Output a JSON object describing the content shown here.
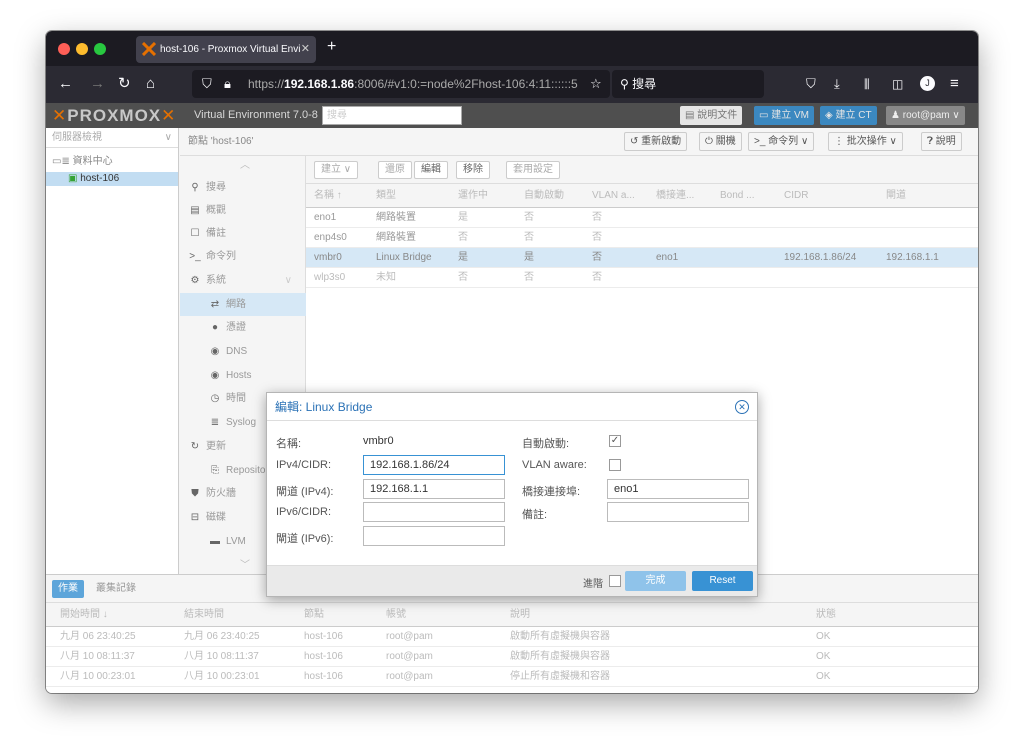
{
  "browser": {
    "tab_title": "host-106 - Proxmox Virtual Envi",
    "tab_close": "✕",
    "new_tab": "+",
    "url_pre": "https://",
    "url_host": "192.168.1.86",
    "url_rest": ":8006/#v1:0:=node%2Fhost-106:4:11::::::5",
    "search_label": "搜尋"
  },
  "pve": {
    "logo": "PROXMOX",
    "version": "Virtual Environment 7.0-8",
    "search_placeholder": "搜尋",
    "docs": "說明文件",
    "create_vm": "建立 VM",
    "create_ct": "建立 CT",
    "user": "root@pam"
  },
  "tree": {
    "view": "伺服器檢視",
    "datacenter": "資料中心",
    "node": "host-106"
  },
  "content": {
    "title": "節點 'host-106'",
    "reboot": "重新啟動",
    "shutdown": "關機",
    "shell": "命令列",
    "bulk": "批次操作",
    "help": "說明"
  },
  "menu": {
    "items": [
      {
        "icon": "⚲",
        "label": "搜尋"
      },
      {
        "icon": "▤",
        "label": "概觀"
      },
      {
        "icon": "☐",
        "label": "備註"
      },
      {
        "icon": ">_",
        "label": "命令列"
      },
      {
        "icon": "⚙",
        "label": "系統"
      },
      {
        "icon": "⇄",
        "label": "網路"
      },
      {
        "icon": "●",
        "label": "憑證"
      },
      {
        "icon": "◉",
        "label": "DNS"
      },
      {
        "icon": "◉",
        "label": "Hosts"
      },
      {
        "icon": "◷",
        "label": "時間"
      },
      {
        "icon": "≣",
        "label": "Syslog"
      },
      {
        "icon": "↻",
        "label": "更新"
      },
      {
        "icon": "⎘",
        "label": "Repositories"
      },
      {
        "icon": "⛊",
        "label": "防火牆"
      },
      {
        "icon": "⊟",
        "label": "磁碟"
      },
      {
        "icon": "▬",
        "label": "LVM"
      }
    ]
  },
  "grid": {
    "toolbar": [
      "建立 ∨",
      "還原",
      "編輯",
      "移除",
      "套用設定"
    ],
    "columns": [
      "名稱 ↑",
      "類型",
      "運作中",
      "自動啟動",
      "VLAN a...",
      "橋接連...",
      "Bond ...",
      "CIDR",
      "閘道"
    ],
    "rows": [
      [
        "eno1",
        "網路裝置",
        "是",
        "否",
        "否",
        "",
        "",
        "",
        ""
      ],
      [
        "enp4s0",
        "網路裝置",
        "否",
        "否",
        "否",
        "",
        "",
        "",
        ""
      ],
      [
        "vmbr0",
        "Linux Bridge",
        "是",
        "是",
        "否",
        "eno1",
        "",
        "192.168.1.86/24",
        "192.168.1.1"
      ],
      [
        "wlp3s0",
        "未知",
        "否",
        "否",
        "否",
        "",
        "",
        "",
        ""
      ]
    ]
  },
  "dialog": {
    "title": "編輯: Linux Bridge",
    "name_label": "名稱:",
    "name_value": "vmbr0",
    "ipv4_label": "IPv4/CIDR:",
    "ipv4_value": "192.168.1.86/24",
    "gw4_label": "閘道 (IPv4):",
    "gw4_value": "192.168.1.1",
    "ipv6_label": "IPv6/CIDR:",
    "ipv6_value": "",
    "gw6_label": "閘道 (IPv6):",
    "gw6_value": "",
    "autostart_label": "自動啟動:",
    "autostart_checked": true,
    "vlan_label": "VLAN aware:",
    "vlan_checked": false,
    "ports_label": "橋接連接埠:",
    "ports_value": "eno1",
    "comment_label": "備註:",
    "comment_value": "",
    "advanced_label": "進階",
    "ok_label": "完成",
    "reset_label": "Reset"
  },
  "log": {
    "tabs": [
      "作業",
      "叢集記錄"
    ],
    "columns": [
      "開始時間 ↓",
      "結束時間",
      "節點",
      "帳號",
      "說明",
      "狀態"
    ],
    "rows": [
      [
        "九月 06 23:40:25",
        "九月 06 23:40:25",
        "host-106",
        "root@pam",
        "啟動所有虛擬機與容器",
        "OK"
      ],
      [
        "八月 10 08:11:37",
        "八月 10 08:11:37",
        "host-106",
        "root@pam",
        "啟動所有虛擬機與容器",
        "OK"
      ],
      [
        "八月 10 00:23:01",
        "八月 10 00:23:01",
        "host-106",
        "root@pam",
        "停止所有虛擬機和容器",
        "OK"
      ]
    ]
  },
  "colors": {
    "accent": "#3892d4",
    "orange": "#e57000",
    "selected_row": "#d6e8f6"
  }
}
